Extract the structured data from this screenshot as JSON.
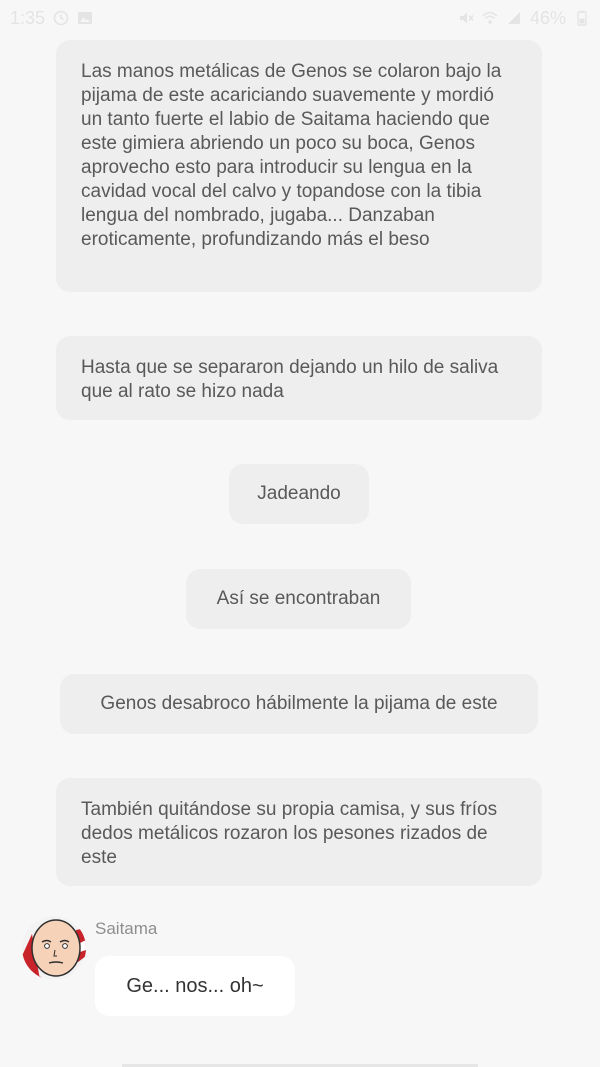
{
  "status_bar": {
    "time": "1:35",
    "battery": "46%"
  },
  "messages": [
    {
      "text": "Las manos metálicas de Genos se colaron bajo la pijama de este acariciando suavemente y mordió un tanto fuerte el labio de Saitama haciendo que este gimiera abriendo un poco su boca, Genos aprovecho esto para introducir su lengua en la cavidad vocal del calvo y topandose con la tibia lengua del nombrado, jugaba... Danzaban eroticamente, profundizando más el beso"
    },
    {
      "text": "Hasta que se separaron dejando un hilo de saliva que al rato se hizo nada"
    },
    {
      "text": "Jadeando"
    },
    {
      "text": "Así se encontraban"
    },
    {
      "text": "Genos desabroco hábilmente la pijama de este"
    },
    {
      "text": "También quitándose su propia camisa, y sus fríos dedos metálicos rozaron los pesones rizados de este"
    }
  ],
  "chat": {
    "sender": "Saitama",
    "message": "Ge... nos... oh~"
  },
  "colors": {
    "background": "#f7f7f7",
    "narration_bubble": "#eeeeee",
    "chat_bubble": "#ffffff",
    "text": "#595959"
  },
  "icons": [
    "alarm-icon",
    "gallery-icon",
    "mute-icon",
    "wifi-icon",
    "signal-icon",
    "battery-icon"
  ]
}
